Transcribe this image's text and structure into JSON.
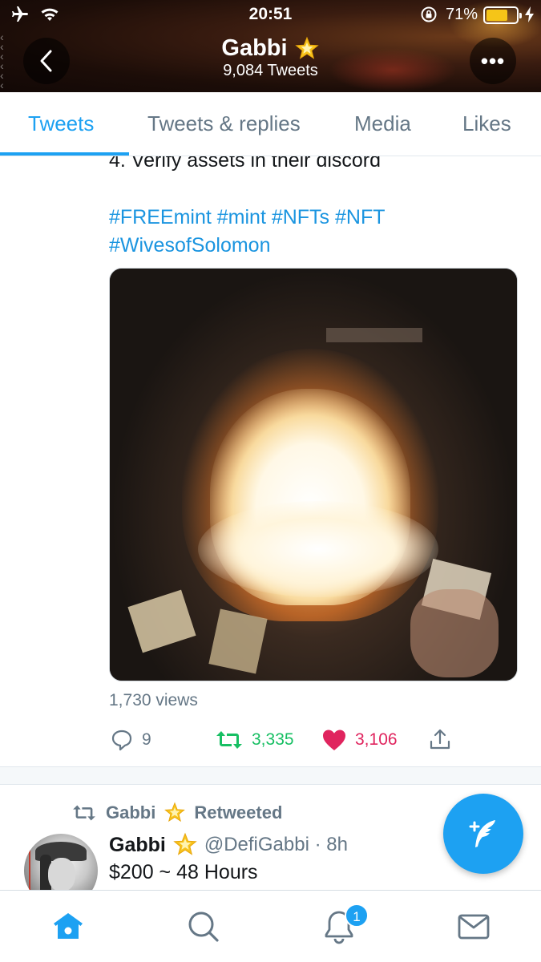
{
  "status_bar": {
    "time": "20:51",
    "battery_percent": "71%",
    "battery_level": 0.71
  },
  "header": {
    "name": "Gabbi",
    "tweet_count": "9,084 Tweets",
    "back_icon": "chevron-left-icon",
    "more_icon": "more-dots-icon",
    "more_label": "•••"
  },
  "tabs": [
    {
      "label": "Tweets",
      "active": true
    },
    {
      "label": "Tweets & replies",
      "active": false
    },
    {
      "label": "Media",
      "active": false
    },
    {
      "label": "Likes",
      "active": false
    }
  ],
  "tweet": {
    "clipped_text": "4. Verify assets in their discord",
    "hashtags_line1": "#FREEmint #mint #NFTs #NFT",
    "hashtags_line2": "#WivesofSolomon",
    "views": "1,730 views",
    "reply_count": "9",
    "retweet_count": "3,335",
    "like_count": "3,106"
  },
  "retweet_context": {
    "who": "Gabbi",
    "label": "Retweeted"
  },
  "tweet2": {
    "name": "Gabbi",
    "handle_time": "@DefiGabbi · 8h",
    "text": "$200 ~ 48 Hours"
  },
  "bottom_nav": {
    "items": [
      "home-icon",
      "search-icon",
      "notifications-icon",
      "messages-icon"
    ],
    "notification_badge": "1"
  },
  "colors": {
    "accent": "#1da1f2",
    "retweet": "#17bf63",
    "like": "#e0245e",
    "muted": "#657786"
  }
}
